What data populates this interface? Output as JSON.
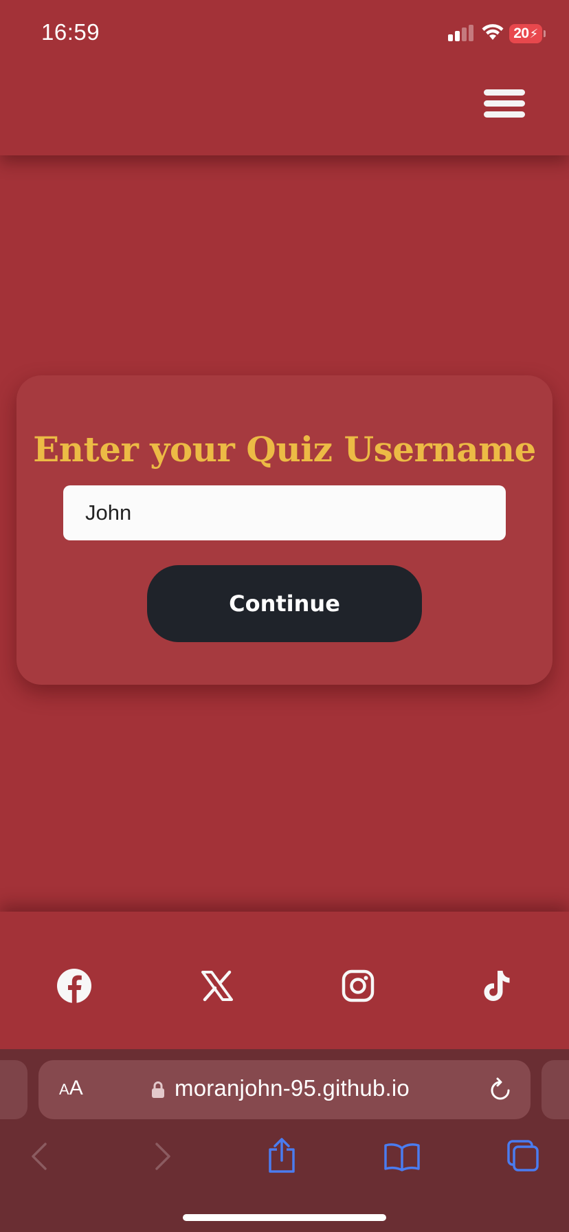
{
  "status_bar": {
    "time": "16:59",
    "battery_level": "20",
    "icons": [
      "signal-icon",
      "wifi-icon",
      "battery-charging-icon"
    ]
  },
  "header": {
    "menu_icon": "hamburger-menu-icon"
  },
  "quiz_form": {
    "title": "Enter your Quiz Username",
    "username_value": "John",
    "continue_label": "Continue"
  },
  "footer": {
    "social_links": [
      {
        "name": "Facebook",
        "icon": "facebook-icon"
      },
      {
        "name": "X",
        "icon": "x-icon"
      },
      {
        "name": "Instagram",
        "icon": "instagram-icon"
      },
      {
        "name": "TikTok",
        "icon": "tiktok-icon"
      }
    ]
  },
  "browser": {
    "text_size_small": "A",
    "text_size_large": "A",
    "url": "moranjohn-95.github.io",
    "nav_icons": [
      "back-icon",
      "forward-icon",
      "share-icon",
      "bookmarks-icon",
      "tabs-icon"
    ]
  },
  "colors": {
    "background": "#a33238",
    "card": "#a63a3f",
    "title": "#ecbb45",
    "button": "#1f232a",
    "browser_chrome": "#6a2e33",
    "browser_accent": "#4a7cf0"
  }
}
